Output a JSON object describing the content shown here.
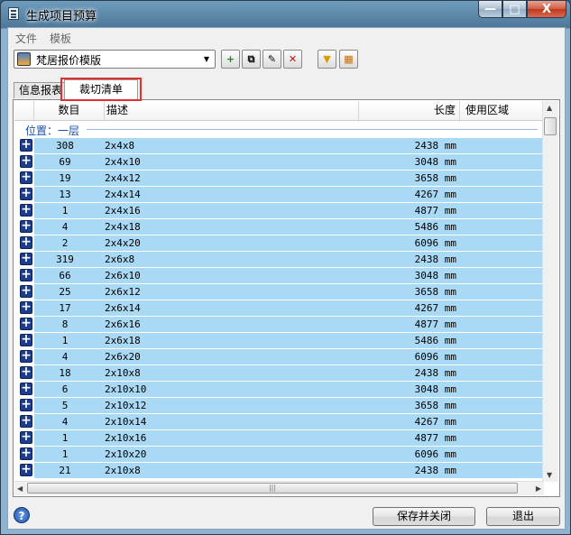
{
  "window": {
    "title": "生成项目预算",
    "controls": {
      "min": "—",
      "max": "□",
      "close": "X"
    }
  },
  "menu": {
    "file": "文件",
    "template": "模板"
  },
  "toolbar": {
    "template_select": "梵居报价模版",
    "buttons": [
      {
        "name": "add-icon",
        "glyph": "+"
      },
      {
        "name": "copy-icon",
        "glyph": "⧉"
      },
      {
        "name": "edit-icon",
        "glyph": "✎"
      },
      {
        "name": "delete-icon",
        "glyph": "✕"
      },
      {
        "name": "filter-icon",
        "glyph": "▼"
      },
      {
        "name": "layers-icon",
        "glyph": "▦"
      }
    ]
  },
  "tabs": [
    {
      "label": "信息报表"
    },
    {
      "label": "裁切清单"
    }
  ],
  "table": {
    "columns": [
      "数目",
      "描述",
      "长度",
      "使用区域"
    ],
    "group_label": "位置：一层",
    "rows": [
      {
        "count": "308",
        "desc": "2x4x8",
        "length": "2438 mm"
      },
      {
        "count": "69",
        "desc": "2x4x10",
        "length": "3048 mm"
      },
      {
        "count": "19",
        "desc": "2x4x12",
        "length": "3658 mm"
      },
      {
        "count": "13",
        "desc": "2x4x14",
        "length": "4267 mm"
      },
      {
        "count": "1",
        "desc": "2x4x16",
        "length": "4877 mm"
      },
      {
        "count": "4",
        "desc": "2x4x18",
        "length": "5486 mm"
      },
      {
        "count": "2",
        "desc": "2x4x20",
        "length": "6096 mm"
      },
      {
        "count": "319",
        "desc": "2x6x8",
        "length": "2438 mm"
      },
      {
        "count": "66",
        "desc": "2x6x10",
        "length": "3048 mm"
      },
      {
        "count": "25",
        "desc": "2x6x12",
        "length": "3658 mm"
      },
      {
        "count": "17",
        "desc": "2x6x14",
        "length": "4267 mm"
      },
      {
        "count": "8",
        "desc": "2x6x16",
        "length": "4877 mm"
      },
      {
        "count": "1",
        "desc": "2x6x18",
        "length": "5486 mm"
      },
      {
        "count": "4",
        "desc": "2x6x20",
        "length": "6096 mm"
      },
      {
        "count": "18",
        "desc": "2x10x8",
        "length": "2438 mm"
      },
      {
        "count": "6",
        "desc": "2x10x10",
        "length": "3048 mm"
      },
      {
        "count": "5",
        "desc": "2x10x12",
        "length": "3658 mm"
      },
      {
        "count": "4",
        "desc": "2x10x14",
        "length": "4267 mm"
      },
      {
        "count": "1",
        "desc": "2x10x16",
        "length": "4877 mm"
      },
      {
        "count": "1",
        "desc": "2x10x20",
        "length": "6096 mm"
      },
      {
        "count": "21",
        "desc": "2x10x8",
        "length": "2438 mm"
      }
    ]
  },
  "footer": {
    "help": "?",
    "save_close": "保存并关闭",
    "exit": "退出"
  }
}
